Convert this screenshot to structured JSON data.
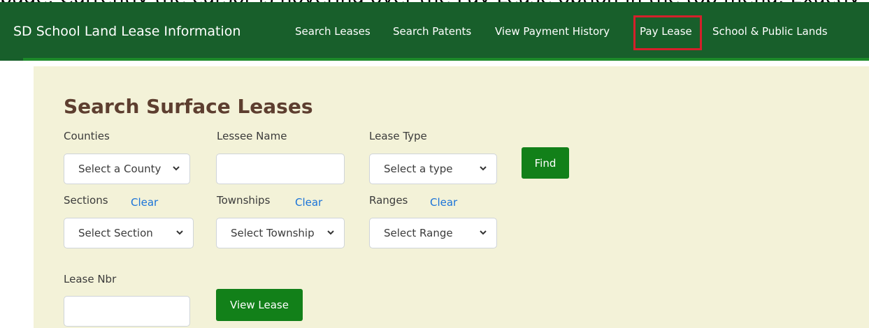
{
  "caption_fragment": "page. Currently the cursor is hovering over the Pay Lease option in the top menu. Exactly",
  "navbar": {
    "brand": "SD School Land Lease Information",
    "links": [
      {
        "label": "Search Leases"
      },
      {
        "label": "Search Patents"
      },
      {
        "label": "View Payment History"
      },
      {
        "label": "Pay Lease"
      },
      {
        "label": "School & Public Lands"
      }
    ],
    "highlight_color": "#d5202b",
    "bar_color": "#185f2b"
  },
  "form": {
    "heading": "Search Surface Leases",
    "counties": {
      "label": "Counties",
      "value": "Select a County"
    },
    "lessee_name": {
      "label": "Lessee Name",
      "value": ""
    },
    "lease_type": {
      "label": "Lease Type",
      "value": "Select a type"
    },
    "find_button": "Find",
    "sections": {
      "label": "Sections",
      "clear": "Clear",
      "value": "Select Section"
    },
    "townships": {
      "label": "Townships",
      "clear": "Clear",
      "value": "Select Township"
    },
    "ranges": {
      "label": "Ranges",
      "clear": "Clear",
      "value": "Select Range"
    },
    "lease_nbr": {
      "label": "Lease Nbr",
      "value": ""
    },
    "view_lease_button": "View Lease",
    "button_color": "#128019",
    "panel_color": "#f3f2d8"
  }
}
